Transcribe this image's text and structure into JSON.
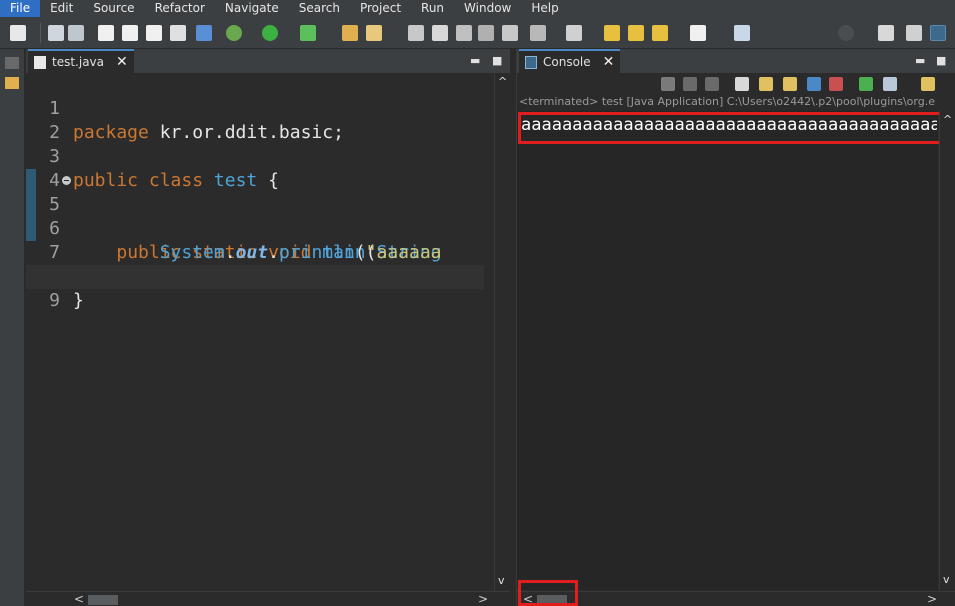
{
  "menu": [
    "File",
    "Edit",
    "Source",
    "Refactor",
    "Navigate",
    "Search",
    "Project",
    "Run",
    "Window",
    "Help"
  ],
  "editor": {
    "tab_label": "test.java",
    "close_glyph": "✕",
    "line_numbers": [
      "1",
      "2",
      "3",
      "4",
      "5",
      "6",
      "7",
      "8",
      "9"
    ],
    "lines": [
      {
        "kw": "package",
        "rest": " kr.or.ddit.basic;"
      },
      {},
      {
        "kw": "public class",
        "cls": "test",
        "rest": " {"
      },
      {},
      {
        "indent": "    ",
        "kw": "public static void",
        "cls": "main",
        "rest": "(",
        "cls2": "String"
      },
      {
        "indent": "        ",
        "cls": "System",
        "dot": ".",
        "fld": "out",
        "mid": ".",
        "cls2": "println",
        "rest": "(",
        "str": "\"aaaaaa"
      },
      {
        "indent": "    ",
        "rest": "}"
      },
      {
        "rest": "}"
      },
      {}
    ]
  },
  "console": {
    "tab_label": "Console",
    "close_glyph": "✕",
    "status": "<terminated> test [Java Application] C:\\Users\\o2442\\.p2\\pool\\plugins\\org.e",
    "output": "aaaaaaaaaaaaaaaaaaaaaaaaaaaaaaaaaaaaaaaaaaaaaaaaaaaaaaaaaaaa"
  },
  "window_controls": {
    "minimize": "▬",
    "maximize": "■"
  },
  "scroll_glyphs": {
    "up": "^",
    "down": "v",
    "left": "<",
    "right": ">"
  },
  "colors": {
    "menu_active": "#2e6fc4",
    "keyword": "#cc7832",
    "class_name": "#4fa3d8",
    "string": "#c9c57a",
    "highlight_box": "#e01e1e"
  }
}
